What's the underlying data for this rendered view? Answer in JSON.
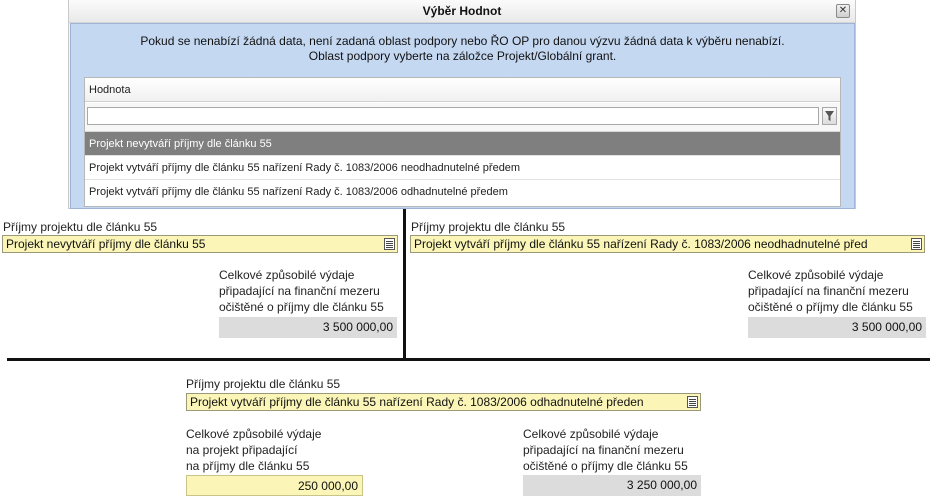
{
  "dialog": {
    "title": "Výběr Hodnot",
    "close_glyph": "✕",
    "info_line1": "Pokud se nenabízí žádná data, není zadaná oblast podpory nebo ŘO OP pro danou výzvu žádná data k výběru nenabízí.",
    "info_line2": "Oblast podpory vyberte na záložce Projekt/Globální grant.",
    "grid": {
      "column_header": "Hodnota",
      "filter_value": "",
      "rows": [
        "Projekt nevytváří příjmy dle článku 55",
        "Projekt vytváří příjmy dle článku 55 nařízení Rady č. 1083/2006 neodhadnutelné předem",
        "Projekt vytváří příjmy dle článku 55 nařízení Rady č. 1083/2006 odhadnutelné předem"
      ],
      "selected_index": 0
    }
  },
  "panel_left": {
    "label": "Příjmy projektu dle článku 55",
    "combo_value": "Projekt nevytváří příjmy dle článku 55",
    "amount_label_1": "Celkové způsobilé výdaje",
    "amount_label_2": "připadající na finanční mezeru",
    "amount_label_3": "očištěné o příjmy dle článku 55",
    "amount": "3 500 000,00"
  },
  "panel_right": {
    "label": "Příjmy projektu dle článku 55",
    "combo_value": "Projekt vytváří příjmy dle článku 55 nařízení Rady č. 1083/2006 neodhadnutelné před",
    "amount_label_1": "Celkové způsobilé výdaje",
    "amount_label_2": "připadající na finanční mezeru",
    "amount_label_3": "očištěné o příjmy dle článku 55",
    "amount": "3 500 000,00"
  },
  "panel_bottom": {
    "label": "Příjmy projektu dle článku 55",
    "combo_value": "Projekt vytváří příjmy dle článku 55 nařízení Rady č. 1083/2006 odhadnutelné předen",
    "revenue_label_1": "Celkové způsobilé výdaje",
    "revenue_label_2": "na projekt připadající",
    "revenue_label_3": "na příjmy dle článku 55",
    "revenue_amount": "250 000,00",
    "amount_label_1": "Celkové způsobilé výdaje",
    "amount_label_2": "připadající na finanční mezeru",
    "amount_label_3": "očištěné o příjmy dle článku 55",
    "amount": "3 250 000,00"
  },
  "colors": {
    "dialog_body": "#c5d8f2",
    "selected_row": "#7f7f7f",
    "combo_bg": "#fbf6b7",
    "readonly_bg": "#dcdcdc"
  },
  "icons": [
    "close-icon",
    "filter-icon",
    "list-icon"
  ]
}
